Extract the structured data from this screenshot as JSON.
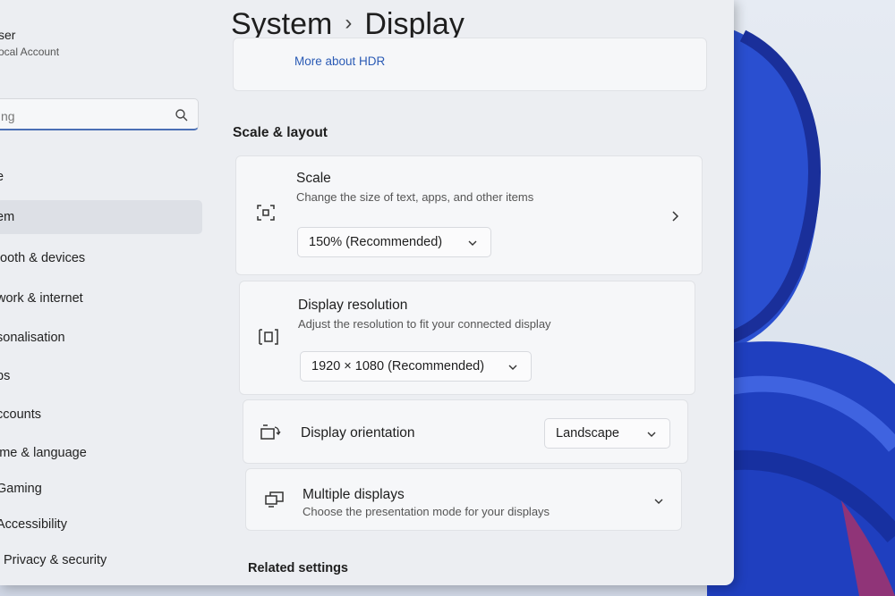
{
  "sidebar": {
    "user_name": "ser",
    "user_type": "ocal Account",
    "search_placeholder": "ng",
    "items": [
      {
        "label": "e"
      },
      {
        "label": "em"
      },
      {
        "label": "tooth & devices"
      },
      {
        "label": "work & internet"
      },
      {
        "label": "sonalisation"
      },
      {
        "label": "ps"
      },
      {
        "label": "ccounts"
      },
      {
        "label": "ime & language"
      },
      {
        "label": "Gaming"
      },
      {
        "label": "Accessibility"
      },
      {
        "label": "Privacy & security"
      }
    ]
  },
  "header": {
    "parent": "System",
    "separator": "›",
    "current": "Display"
  },
  "hdr_card": {
    "link": "More about HDR"
  },
  "scale_layout": {
    "heading": "Scale & layout",
    "scale": {
      "title": "Scale",
      "subtitle": "Change the size of text, apps, and other items",
      "value": "150% (Recommended)"
    },
    "resolution": {
      "title": "Display resolution",
      "subtitle": "Adjust the resolution to fit your connected display",
      "value": "1920 × 1080 (Recommended)"
    },
    "orientation": {
      "title": "Display orientation",
      "value": "Landscape"
    },
    "multiple": {
      "title": "Multiple displays",
      "subtitle": "Choose the presentation mode for your displays"
    }
  },
  "related": {
    "heading": "Related settings"
  },
  "colors": {
    "accent": "#2b5bb5",
    "wallpaper_blue": "#1f3fbf"
  }
}
